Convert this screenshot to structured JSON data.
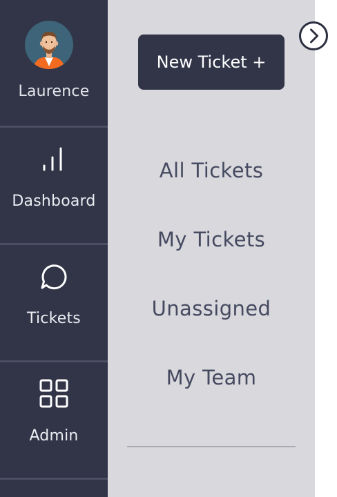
{
  "user": {
    "name": "Laurence"
  },
  "nav": {
    "items": [
      {
        "label": "Dashboard",
        "icon": "bar-chart-icon"
      },
      {
        "label": "Tickets",
        "icon": "chat-bubble-icon"
      },
      {
        "label": "Admin",
        "icon": "grid-icon"
      }
    ]
  },
  "panel": {
    "new_ticket_label": "New Ticket +",
    "links": [
      {
        "label": "All Tickets"
      },
      {
        "label": "My Tickets"
      },
      {
        "label": "Unassigned"
      },
      {
        "label": "My Team"
      }
    ]
  },
  "toggle": {
    "icon": "chevron-right-icon"
  },
  "colors": {
    "sidebar_bg": "#323548",
    "panel_bg": "#d9d8dd",
    "link_text": "#454a60",
    "button_bg": "#323548"
  }
}
